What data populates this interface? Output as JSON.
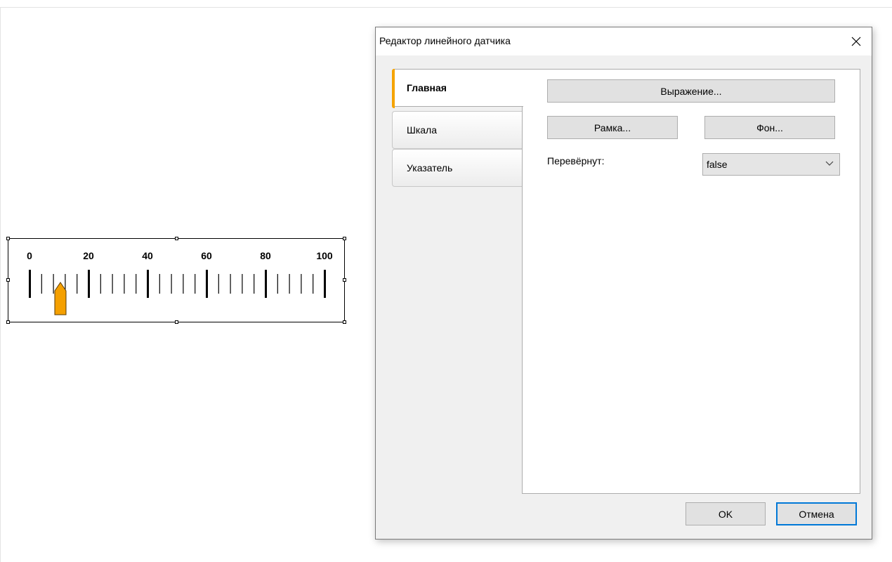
{
  "dialog": {
    "title": "Редактор линейного датчика",
    "tabs": [
      {
        "label": "Главная",
        "active": true
      },
      {
        "label": "Шкала",
        "active": false
      },
      {
        "label": "Указатель",
        "active": false
      }
    ],
    "main": {
      "expression_label": "Выражение...",
      "border_label": "Рамка...",
      "background_label": "Фон...",
      "flipped_label": "Перевёрнут:",
      "flipped_value": "false"
    },
    "ok_label": "OK",
    "cancel_label": "Отмена"
  },
  "gauge": {
    "scale_labels": [
      "0",
      "20",
      "40",
      "60",
      "80",
      "100"
    ],
    "min": 0,
    "max": 100,
    "major_step": 20,
    "minor_step": 4,
    "pointer_value": 10,
    "pointer_color": "#f5a000"
  },
  "colors": {
    "accent": "#f5a300",
    "focus_border": "#0078d7"
  }
}
